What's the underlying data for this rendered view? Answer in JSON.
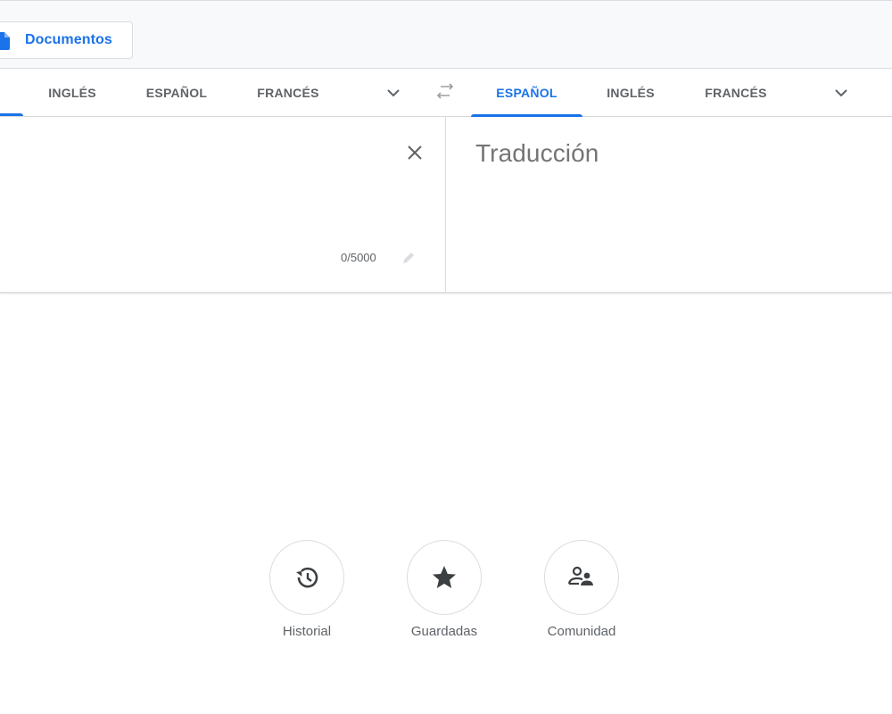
{
  "documents_button": {
    "label": "Documentos",
    "icon": "document-icon",
    "color": "#1a73e8"
  },
  "source_languages": {
    "tabs": [
      "INGLÉS",
      "ESPAÑOL",
      "FRANCÉS"
    ],
    "more_icon": "chevron-down-icon"
  },
  "swap_icon": "swap-languages-icon",
  "target_languages": {
    "tabs": [
      "ESPAÑOL",
      "INGLÉS",
      "FRANCÉS"
    ],
    "active": "ESPAÑOL",
    "more_icon": "chevron-down-icon"
  },
  "source_pane": {
    "clear_icon": "close-icon",
    "char_count": "0/5000",
    "edit_icon": "pencil-icon"
  },
  "target_pane": {
    "placeholder": "Traducción"
  },
  "quick_actions": [
    {
      "label": "Historial",
      "icon": "history-icon"
    },
    {
      "label": "Guardadas",
      "icon": "star-icon"
    },
    {
      "label": "Comunidad",
      "icon": "community-icon"
    }
  ],
  "colors": {
    "accent": "#1a73e8",
    "text_muted": "#5f6368",
    "border": "#dadce0"
  }
}
